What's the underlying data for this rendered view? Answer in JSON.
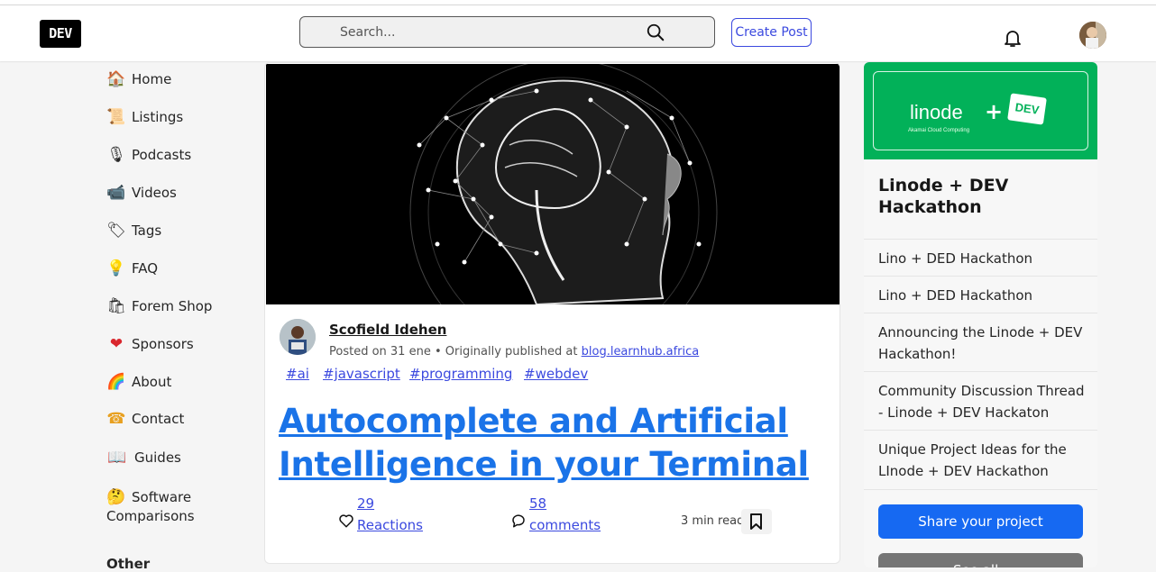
{
  "header": {
    "logo": "DEV",
    "search_placeholder": "Search...",
    "create_post": "Create Post"
  },
  "sidebar": {
    "items": [
      {
        "icon": "house-icon",
        "glyph": "🏠",
        "label": "Home"
      },
      {
        "icon": "scroll-icon",
        "glyph": "📜",
        "label": "Listings"
      },
      {
        "icon": "microphone-icon",
        "glyph": "🎙",
        "label": "Podcasts"
      },
      {
        "icon": "video-camera-icon",
        "glyph": "📹",
        "label": "Videos"
      },
      {
        "icon": "tag-icon",
        "glyph": "🏷",
        "label": "Tags"
      },
      {
        "icon": "lightbulb-icon",
        "glyph": "💡",
        "label": "FAQ"
      },
      {
        "icon": "shopping-bags-icon",
        "glyph": "🛍",
        "label": "Forem Shop"
      },
      {
        "icon": "heart-icon",
        "glyph": "❤",
        "label": "Sponsors"
      },
      {
        "icon": "dev-rainbow-icon",
        "glyph": "🌈",
        "label": "About"
      },
      {
        "icon": "phone-icon",
        "glyph": "☎",
        "label": "Contact"
      },
      {
        "icon": "book-icon",
        "glyph": "📖",
        "label": "Guides"
      },
      {
        "icon": "thinking-face-icon",
        "glyph": "🤔",
        "label": "Software",
        "label2": "Comparisons"
      }
    ],
    "other_heading": "Other"
  },
  "post": {
    "author": "Scofield Idehen",
    "posted_prefix": "Posted on 31 ene • Originally published at ",
    "posted_link": "blog.learnhub.africa",
    "tags": [
      "#ai",
      "#javascript",
      "#programming",
      "#webdev"
    ],
    "title_line1": "Autocomplete and Artificial",
    "title_line2": "Intelligence in your Terminal",
    "reactions_count": "29",
    "reactions_label": "Reactions",
    "comments_count": "58",
    "comments_label": "comments",
    "read_time": "3 min read"
  },
  "right_panel": {
    "banner_logo": "linode",
    "banner_sub": "Akamai Cloud Computing",
    "banner_plus": "+",
    "banner_dev": "DEV",
    "title": "Linode + DEV Hackathon",
    "items": [
      "Lino + DED Hackathon",
      "Lino + DED Hackathon",
      "Announcing the Linode + DEV Hackathon!",
      "Community Discussion Thread - Linode + DEV Hackaton",
      "Unique Project Ideas for the LInode + DEV Hackathon"
    ],
    "share_button": "Share your project",
    "second_button": "See all ›"
  },
  "colors": {
    "accent": "#3b49df",
    "title_link": "#1a73e8",
    "banner_green": "#02b159",
    "share_blue": "#1669f2"
  }
}
